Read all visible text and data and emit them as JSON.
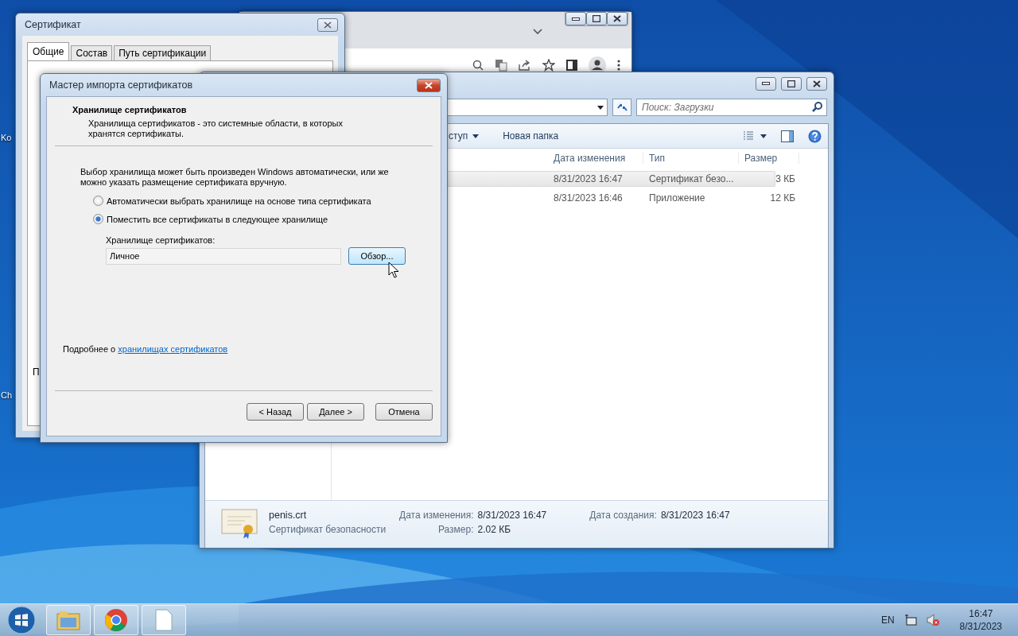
{
  "desktop": {
    "icon_labels": [
      "Ko",
      "Ch"
    ]
  },
  "certificate_window": {
    "title": "Сертификат",
    "tabs": [
      {
        "label": "Общие",
        "selected": true
      },
      {
        "label": "Состав",
        "selected": false
      },
      {
        "label": "Путь сертификации",
        "selected": false
      }
    ],
    "fragment": "П"
  },
  "explorer": {
    "search": {
      "placeholder": "Поиск: Загрузки"
    },
    "toolbar": [
      {
        "label": "ступ",
        "dropdown": true
      },
      {
        "label": "Новая папка",
        "dropdown": false
      }
    ],
    "columns": [
      "Дата изменения",
      "Тип",
      "Размер"
    ],
    "rows": [
      {
        "modified": "8/31/2023 16:47",
        "type": "Сертификат безо...",
        "size": "3 КБ",
        "selected": true
      },
      {
        "modified": "8/31/2023 16:46",
        "type": "Приложение",
        "size": "12 КБ",
        "selected": false
      }
    ],
    "details": {
      "name": "penis.crt",
      "kind_label": "Сертификат безопасности",
      "fields": [
        {
          "label": "Дата изменения:",
          "value": "8/31/2023 16:47"
        },
        {
          "label": "Размер:",
          "value": "2.02 КБ"
        },
        {
          "label": "Дата создания:",
          "value": "8/31/2023 16:47"
        }
      ]
    }
  },
  "wizard": {
    "title": "Мастер импорта сертификатов",
    "heading": "Хранилище сертификатов",
    "description": "Хранилища сертификатов - это системные области, в которых хранятся сертификаты.",
    "intro": "Выбор хранилища может быть произведен Windows автоматически, или же можно указать размещение сертификата вручную.",
    "options": [
      {
        "label": "Автоматически выбрать хранилище на основе типа сертификата",
        "selected": false
      },
      {
        "label": "Поместить все сертификаты в следующее хранилище",
        "selected": true
      }
    ],
    "store_label": "Хранилище сертификатов:",
    "store_value": "Личное",
    "browse_button": "Обзор...",
    "more_text": "Подробнее о",
    "more_link": "хранилищах сертификатов",
    "buttons": [
      {
        "label": "< Назад",
        "kind": "back"
      },
      {
        "label": "Далее >",
        "kind": "next"
      },
      {
        "label": "Отмена",
        "kind": "cancel"
      }
    ]
  },
  "taskbar": {
    "language": "EN",
    "time": "16:47",
    "date": "8/31/2023"
  }
}
